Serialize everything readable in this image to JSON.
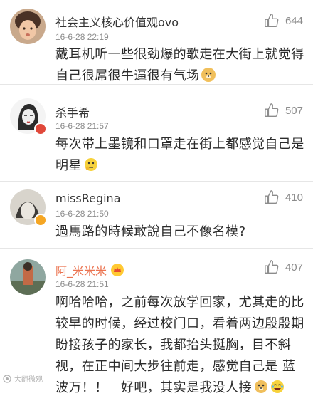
{
  "comments": [
    {
      "name": "社会主义核心价值观ovo",
      "time": "16-6-28 22:19",
      "likes": "644",
      "line1": "戴耳机听一些很劲爆的歌走在大街上就觉得",
      "line2": "自己很屌很牛逼很有气场",
      "avatar_icon": "girl-avatar",
      "emoji": "doge-emoji"
    },
    {
      "name": "杀手希",
      "time": "16-6-28 21:57",
      "likes": "507",
      "line1": "每次带上墨镜和口罩走在街上都感觉自己是",
      "line2": "明星",
      "avatar_icon": "sketch-avatar",
      "emoji": "thinking-emoji"
    },
    {
      "name": "missRegina",
      "time": "16-6-28 21:50",
      "likes": "410",
      "line1": "過馬路的時候敢說自己不像名模?",
      "avatar_icon": "abstract-avatar"
    },
    {
      "name": "阿_米米米",
      "time": "16-6-28 21:51",
      "likes": "407",
      "line1": "啊哈哈哈，之前每次放学回家，尤其走的比",
      "line2": "较早的时候，经过校门口，看着两边殷殷期",
      "line3": "盼接孩子的家长，我都抬头挺胸，目不斜",
      "line4": "视，在正中间大步往前走，感觉自己是 蓝",
      "line5": "波万！！   好吧，其实是我没人接",
      "avatar_icon": "photo-avatar",
      "emoji": "doge-emoji",
      "emoji2": "laugh-cry-emoji"
    }
  ],
  "watermark": {
    "text": "大翻微观"
  },
  "colors": {
    "vip_name": "#eb7350",
    "secondary": "#8c8c8c"
  }
}
